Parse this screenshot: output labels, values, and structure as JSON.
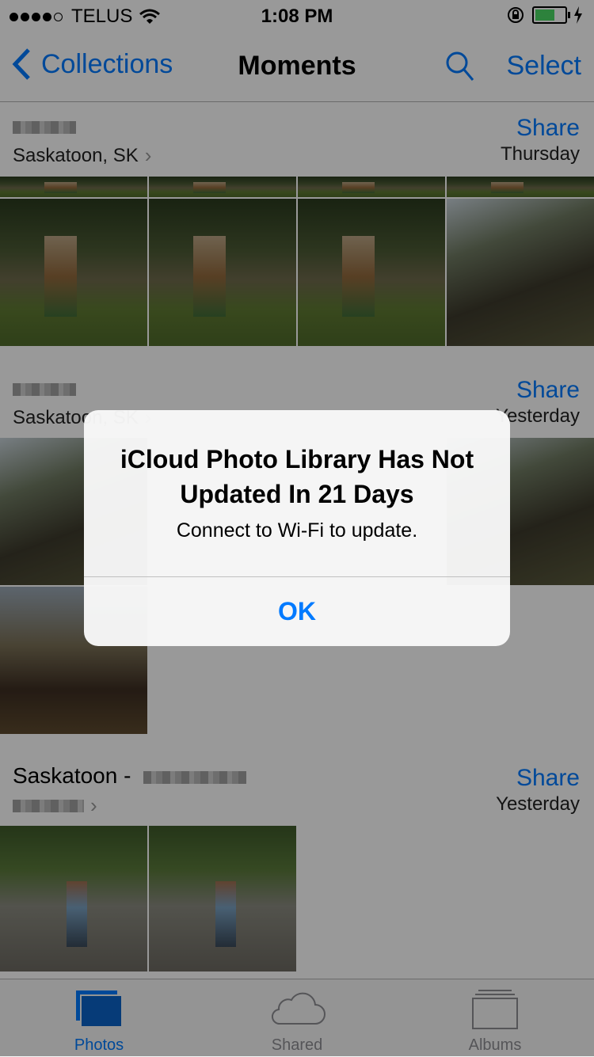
{
  "status_bar": {
    "carrier": "TELUS",
    "time": "1:08 PM"
  },
  "nav": {
    "back_label": "Collections",
    "title": "Moments",
    "select_label": "Select",
    "search_icon": "search-icon"
  },
  "moments": [
    {
      "title": "",
      "location": "Saskatoon, SK",
      "share_label": "Share",
      "date": "Thursday"
    },
    {
      "title": "",
      "location": "Saskatoon, SK",
      "share_label": "Share",
      "date": "Yesterday"
    },
    {
      "title": "Saskatoon -",
      "location": "",
      "share_label": "Share",
      "date": "Yesterday"
    }
  ],
  "tab_bar": {
    "tabs": [
      {
        "label": "Photos",
        "icon": "photos-icon",
        "active": true
      },
      {
        "label": "Shared",
        "icon": "cloud-icon",
        "active": false
      },
      {
        "label": "Albums",
        "icon": "albums-icon",
        "active": false
      }
    ]
  },
  "alert": {
    "title": "iCloud Photo Library Has Not Updated In 21 Days",
    "message": "Connect to Wi-Fi to update.",
    "ok_label": "OK"
  },
  "colors": {
    "accent": "#007aff",
    "battery": "#4cd964"
  }
}
